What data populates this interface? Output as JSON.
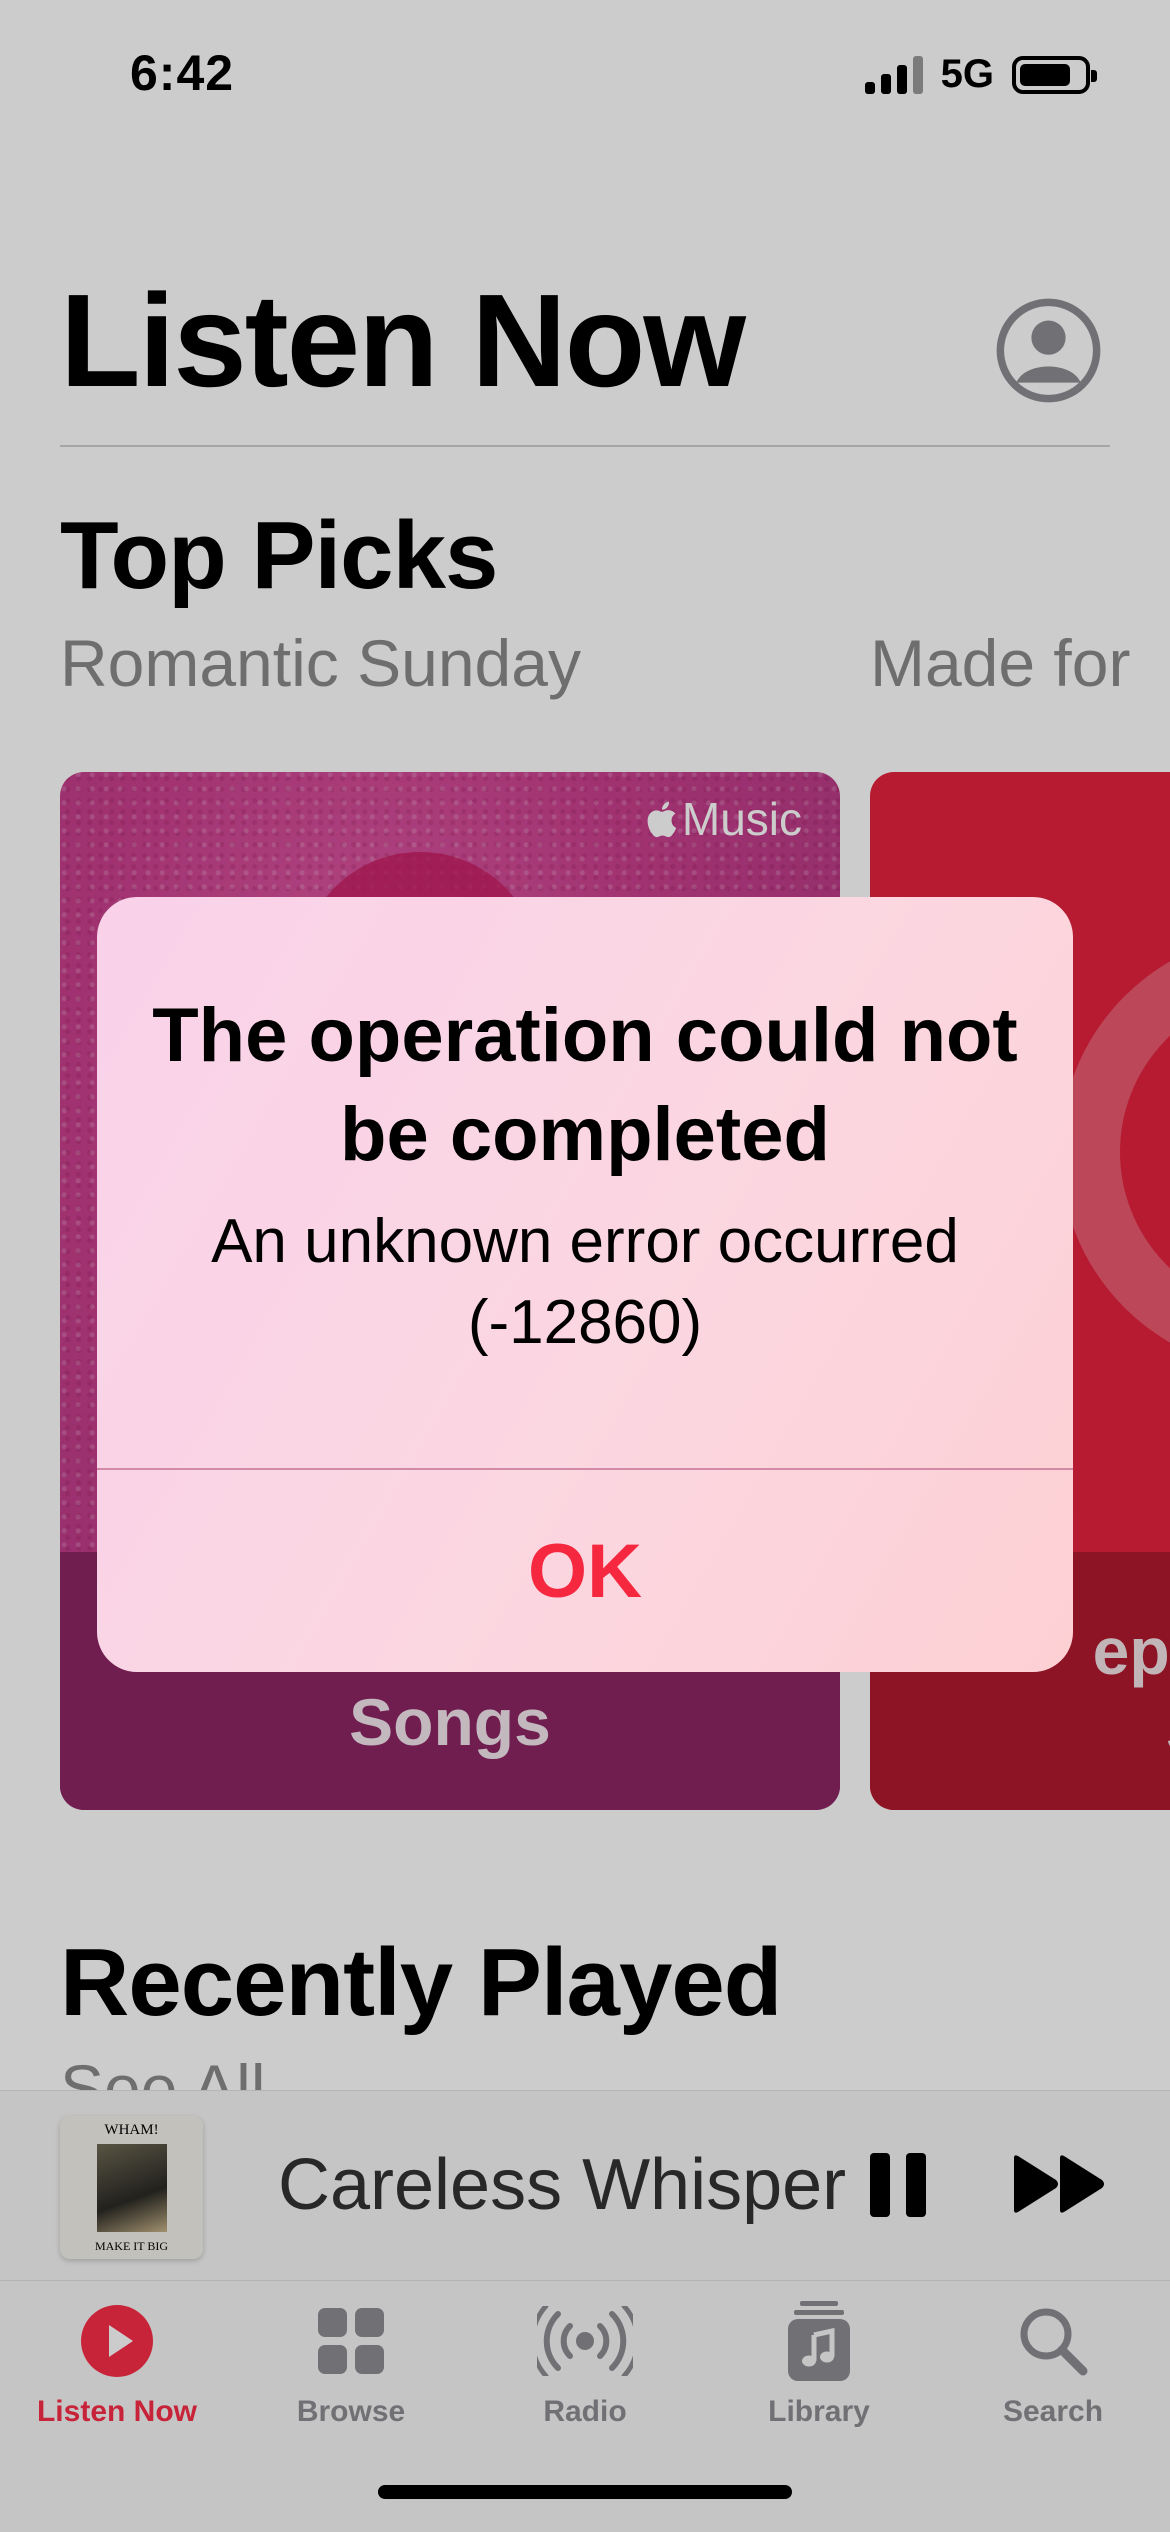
{
  "status_bar": {
    "time": "6:42",
    "network": "5G"
  },
  "header": {
    "title": "Listen Now"
  },
  "top_picks": {
    "title": "Top Picks",
    "cards": [
      {
        "label": "Romantic Sunday",
        "badge": "Music",
        "caption": "Songs"
      },
      {
        "label": "Made for",
        "caption": "eph\nS"
      }
    ]
  },
  "recently_played": {
    "title": "Recently Played",
    "see_all": "See All"
  },
  "mini_player": {
    "album_top_text": "WHAM!",
    "album_bottom_text": "MAKE IT BIG",
    "track_title": "Careless Whisper"
  },
  "tabs": [
    {
      "label": "Listen Now",
      "icon": "play-circle-icon",
      "active": true
    },
    {
      "label": "Browse",
      "icon": "grid-icon",
      "active": false
    },
    {
      "label": "Radio",
      "icon": "radio-broadcast-icon",
      "active": false
    },
    {
      "label": "Library",
      "icon": "music-library-icon",
      "active": false
    },
    {
      "label": "Search",
      "icon": "search-icon",
      "active": false
    }
  ],
  "alert": {
    "title": "The operation could not be completed",
    "message": "An unknown error occurred (-12860)",
    "ok_label": "OK"
  },
  "colors": {
    "accent": "#fa2d48",
    "alert_button": "#f5283f",
    "inactive_tab": "#8e8e93"
  }
}
